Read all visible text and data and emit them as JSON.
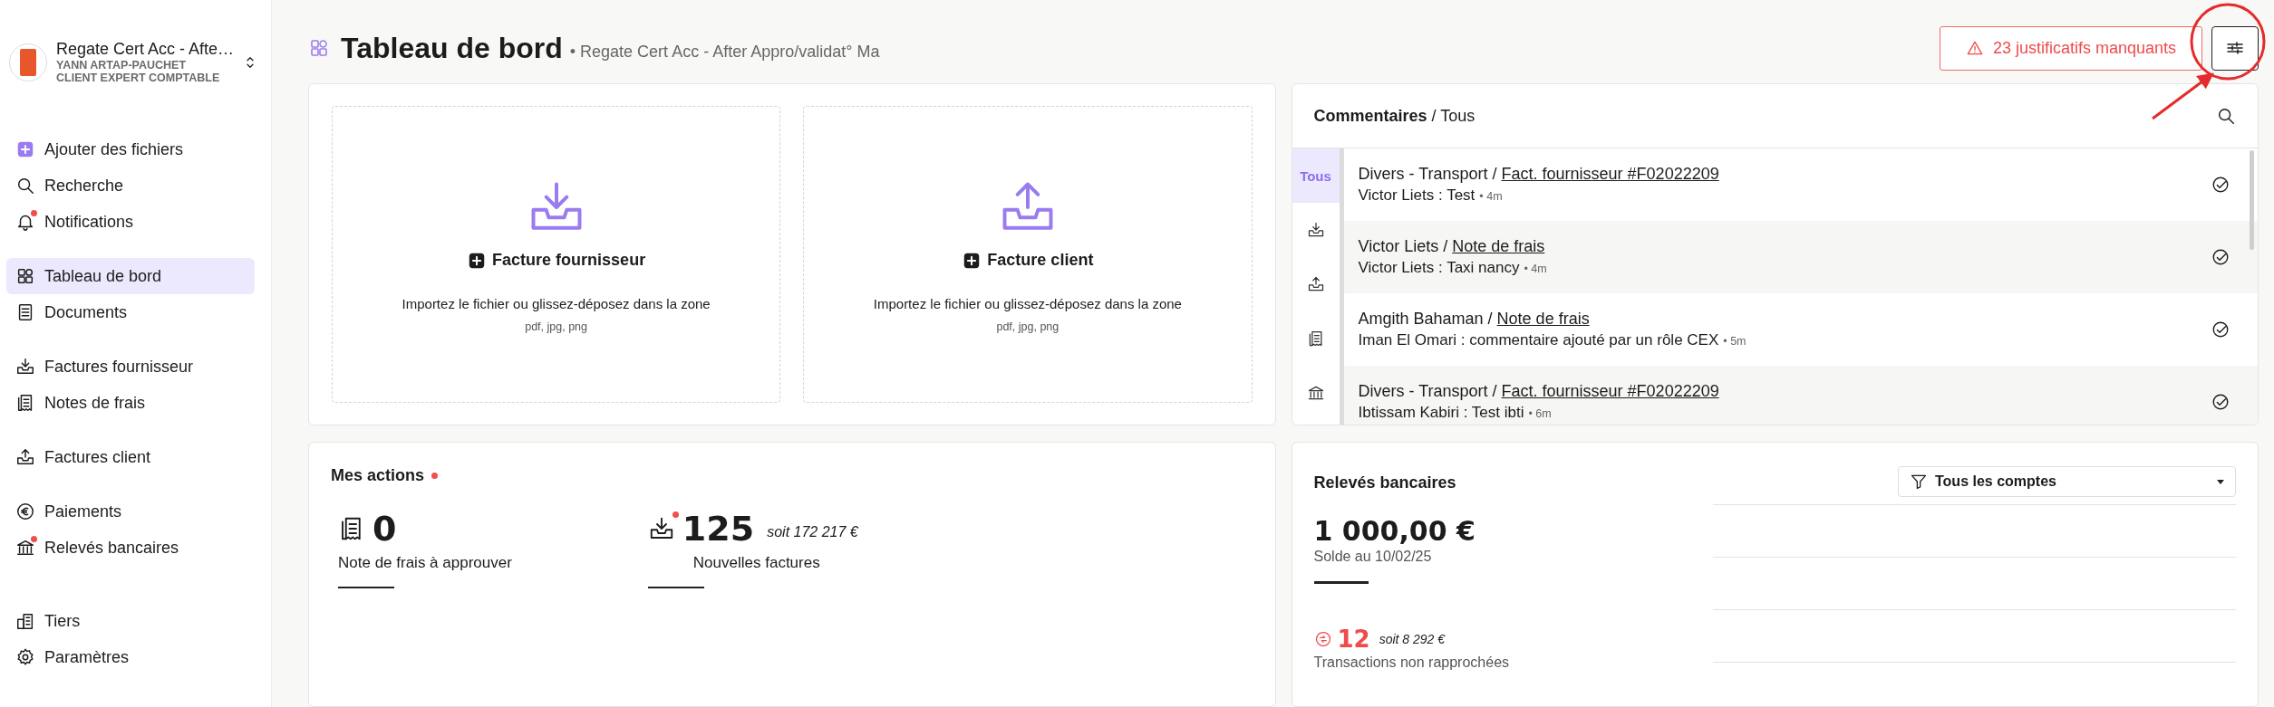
{
  "sidebar": {
    "account": {
      "name": "Regate Cert Acc - Afte…",
      "user": "YANN ARTAP-PAUCHET",
      "role": "CLIENT EXPERT COMPTABLE"
    },
    "groups": [
      {
        "items": [
          {
            "label": "Ajouter des fichiers",
            "selected": false,
            "notified": false
          },
          {
            "label": "Recherche",
            "selected": false,
            "notified": false
          },
          {
            "label": "Notifications",
            "selected": false,
            "notified": true
          }
        ]
      },
      {
        "items": [
          {
            "label": "Tableau de bord",
            "selected": true,
            "notified": false
          },
          {
            "label": "Documents",
            "selected": false,
            "notified": false
          }
        ]
      },
      {
        "items": [
          {
            "label": "Factures fournisseur",
            "selected": false,
            "notified": false
          },
          {
            "label": "Notes de frais",
            "selected": false,
            "notified": false
          }
        ]
      },
      {
        "items": [
          {
            "label": "Factures client",
            "selected": false,
            "notified": false
          }
        ]
      },
      {
        "items": [
          {
            "label": "Paiements",
            "selected": false,
            "notified": false
          },
          {
            "label": "Relevés bancaires",
            "selected": false,
            "notified": true
          }
        ]
      },
      {
        "items": [
          {
            "label": "Tiers",
            "selected": false,
            "notified": false
          },
          {
            "label": "Paramètres",
            "selected": false,
            "notified": false
          }
        ]
      }
    ]
  },
  "header": {
    "title": "Tableau de bord",
    "subtitle": "• Regate Cert Acc - After Appro/validat° Ma",
    "alert": "23 justificatifs manquants"
  },
  "upload_zones": [
    {
      "label": "Facture fournisseur",
      "hint": "Importez le fichier ou glissez-déposez dans la zone",
      "formats": "pdf, jpg, png"
    },
    {
      "label": "Facture client",
      "hint": "Importez le fichier ou glissez-déposez dans la zone",
      "formats": "pdf, jpg, png"
    }
  ],
  "comments": {
    "title": "**Commentaires** / Tous",
    "tabs": [
      {
        "label": "Tous",
        "selected": true
      },
      {
        "selected": false
      },
      {
        "selected": false
      },
      {
        "selected": false
      },
      {
        "selected": false
      }
    ],
    "items": [
      {
        "context": "Divers - Transport / ",
        "link": "Fact. fournisseur #F02022209",
        "text": "Victor Liets : Test",
        "time": "• 4m"
      },
      {
        "context": "Victor Liets / ",
        "link": "Note de frais",
        "text": "Victor Liets : Taxi nancy",
        "time": "• 4m"
      },
      {
        "context": "Amgith Bahaman / ",
        "link": "Note de frais",
        "text": "Iman El Omari : commentaire ajouté par un rôle CEX",
        "time": "• 5m"
      },
      {
        "context": "Divers - Transport / ",
        "link": "Fact. fournisseur #F02022209",
        "text": "Ibtissam Kabiri : Test ibti",
        "time": "• 6m"
      }
    ]
  },
  "actions": {
    "title": "Mes actions",
    "notified": true,
    "stats": [
      {
        "value": "0",
        "label": "Note de frais à approuver",
        "notified": false
      },
      {
        "value": "125",
        "extra": "soit 172 217 €",
        "label": "Nouvelles factures",
        "notified": true
      }
    ]
  },
  "bank": {
    "title": "Relevés bancaires",
    "filter": "Tous les comptes",
    "balance": "1 000,00 €",
    "balance_label": "Solde au 10/02/25",
    "unmatched": {
      "count": "12",
      "extra": "soit 8 292 €",
      "label": "Transactions non rapprochées"
    }
  }
}
